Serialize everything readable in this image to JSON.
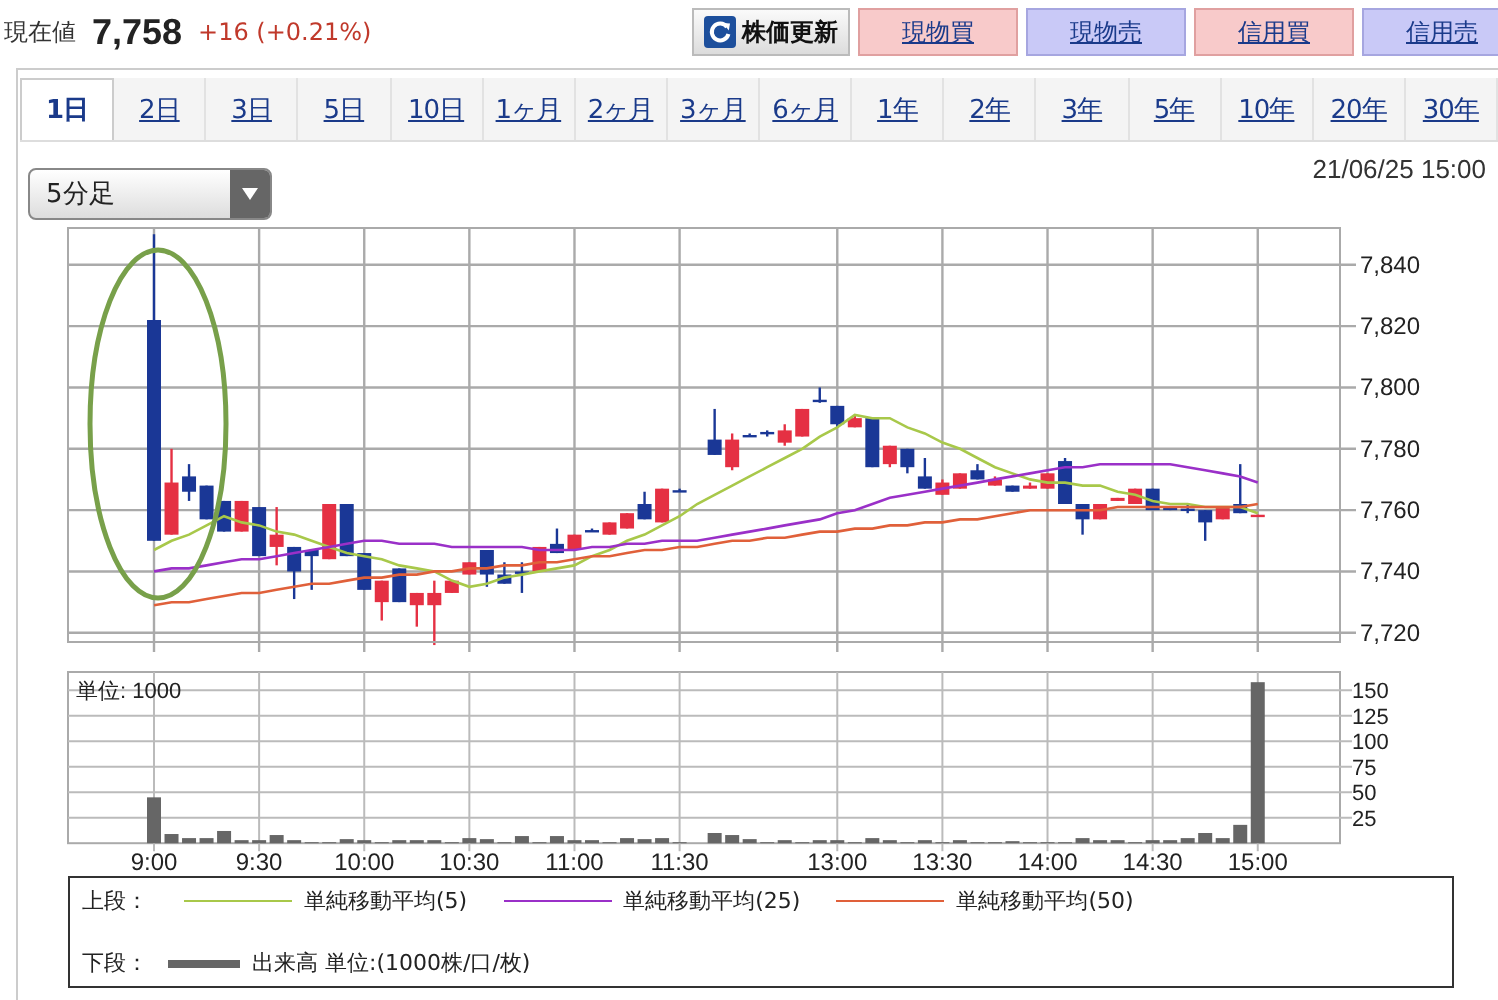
{
  "quote": {
    "label": "現在値",
    "price": "7,758",
    "change": "+16 (+0.21%)"
  },
  "buttons": [
    {
      "label": "株価更新",
      "kind": "refresh"
    },
    {
      "label": "現物買",
      "kind": "buy"
    },
    {
      "label": "現物売",
      "kind": "sell"
    },
    {
      "label": "信用買",
      "kind": "buy"
    },
    {
      "label": "信用売",
      "kind": "sell"
    }
  ],
  "tabs": [
    {
      "label": "1日",
      "selected": true
    },
    {
      "label": "2日",
      "selected": false
    },
    {
      "label": "3日",
      "selected": false
    },
    {
      "label": "5日",
      "selected": false
    },
    {
      "label": "10日",
      "selected": false
    },
    {
      "label": "1ヶ月",
      "selected": false
    },
    {
      "label": "2ヶ月",
      "selected": false
    },
    {
      "label": "3ヶ月",
      "selected": false
    },
    {
      "label": "6ヶ月",
      "selected": false
    },
    {
      "label": "1年",
      "selected": false
    },
    {
      "label": "2年",
      "selected": false
    },
    {
      "label": "3年",
      "selected": false
    },
    {
      "label": "5年",
      "selected": false
    },
    {
      "label": "10年",
      "selected": false
    },
    {
      "label": "20年",
      "selected": false
    },
    {
      "label": "30年",
      "selected": false
    }
  ],
  "interval_select": {
    "value": "5分足"
  },
  "timestamp": "21/06/25 15:00",
  "price_chart": {
    "chart_data": {
      "type": "candlestick",
      "grid": true,
      "ylim": [
        7717,
        7852
      ],
      "ohlc": [
        [
          7822,
          7850,
          7750,
          7750
        ],
        [
          7752,
          7780,
          7752,
          7769
        ],
        [
          7771,
          7775,
          7763,
          7766
        ],
        [
          7768,
          7768,
          7757,
          7757
        ],
        [
          7763,
          7763,
          7753,
          7753
        ],
        [
          7753,
          7763,
          7753,
          7763
        ],
        [
          7761,
          7761,
          7745,
          7745
        ],
        [
          7748,
          7761,
          7742,
          7752
        ],
        [
          7748,
          7748,
          7731,
          7740
        ],
        [
          7747,
          7747,
          7734,
          7745
        ],
        [
          7744,
          7762,
          7744,
          7762
        ],
        [
          7762,
          7762,
          7745,
          7745
        ],
        [
          7746,
          7746,
          7734,
          7734
        ],
        [
          7730,
          7737,
          7724,
          7737
        ],
        [
          7741,
          7741,
          7730,
          7730
        ],
        [
          7729,
          7733,
          7722,
          7733
        ],
        [
          7729,
          7737,
          7716,
          7733
        ],
        [
          7733,
          7737,
          7733,
          7737
        ],
        [
          7739,
          7743,
          7739,
          7743
        ],
        [
          7747,
          7747,
          7735,
          7739
        ],
        [
          7739,
          7743,
          7736,
          7736
        ],
        [
          7740,
          7743,
          7733,
          7739.5
        ],
        [
          7740,
          7748,
          7740,
          7748
        ],
        [
          7749,
          7754,
          7746,
          7746
        ],
        [
          7747,
          7752,
          7747,
          7752
        ],
        [
          7753.5,
          7754,
          7753,
          7753
        ],
        [
          7752,
          7756,
          7752,
          7756
        ],
        [
          7754,
          7759,
          7754,
          7759
        ],
        [
          7762,
          7766,
          7757,
          7757
        ],
        [
          7756,
          7767,
          7756,
          7767
        ],
        [
          7766.5,
          7767,
          7766,
          7766
        ],
        null,
        [
          7783,
          7793,
          7778,
          7778
        ],
        [
          7774,
          7785,
          7773,
          7783
        ],
        [
          7784.5,
          7785,
          7784,
          7784
        ],
        [
          7785.5,
          7786,
          7784,
          7785
        ],
        [
          7782,
          7788,
          7781,
          7786
        ],
        [
          7784,
          7793,
          7784,
          7793
        ],
        [
          7796,
          7800,
          7795,
          7795.5
        ],
        [
          7794,
          7794,
          7787,
          7788
        ],
        [
          7787,
          7791,
          7787,
          7790
        ],
        [
          7790,
          7790,
          7774,
          7774
        ],
        [
          7775,
          7781,
          7774,
          7781
        ],
        [
          7780,
          7780,
          7772,
          7774
        ],
        [
          7771,
          7777,
          7767,
          7767
        ],
        [
          7765,
          7770,
          7765,
          7769
        ],
        [
          7767,
          7772,
          7767,
          7772
        ],
        [
          7773,
          7775,
          7770,
          7770
        ],
        [
          7768,
          7771,
          7768,
          7770
        ],
        [
          7768,
          7768,
          7766,
          7766
        ],
        [
          7767,
          7769,
          7767,
          7768
        ],
        [
          7767,
          7772,
          7767,
          7772
        ],
        [
          7776,
          7777,
          7762,
          7762
        ],
        [
          7762,
          7762,
          7752,
          7757
        ],
        [
          7757,
          7762,
          7757,
          7762
        ],
        [
          7763,
          7764,
          7763,
          7764
        ],
        [
          7762,
          7767,
          7762,
          7767
        ],
        [
          7767,
          7767,
          7760,
          7760
        ],
        [
          7761,
          7761,
          7760,
          7760
        ],
        [
          7760.5,
          7762,
          7759,
          7760
        ],
        [
          7760,
          7760,
          7750,
          7756
        ],
        [
          7757,
          7761,
          7757,
          7761
        ],
        [
          7762,
          7775,
          7759,
          7759
        ],
        [
          7758,
          7758.5,
          7758,
          7758.5
        ]
      ],
      "categories": [
        null,
        null,
        null,
        null,
        null,
        null,
        null,
        null,
        null,
        null,
        null,
        null,
        null,
        null,
        null,
        null,
        null,
        null,
        null,
        null,
        null,
        null,
        null,
        null,
        null,
        null,
        null,
        null,
        null,
        null,
        null,
        null,
        null,
        null,
        null,
        null,
        null,
        null,
        null,
        null,
        null,
        null,
        null,
        null,
        null,
        null,
        null,
        null,
        null,
        null,
        null,
        null,
        null,
        null,
        null,
        null,
        null,
        null,
        null,
        null,
        null,
        null,
        null,
        null
      ],
      "yticks": [
        {
          "value": 7720,
          "label": "7,720"
        },
        {
          "value": 7740,
          "label": "7,740"
        },
        {
          "value": 7760,
          "label": "7,760"
        },
        {
          "value": 7780,
          "label": "7,780"
        },
        {
          "value": 7800,
          "label": "7,800"
        },
        {
          "value": 7820,
          "label": "7,820"
        },
        {
          "value": 7840,
          "label": "7,840"
        }
      ]
    },
    "moving_averages": {
      "chart_data": {
        "type": "line",
        "ylim": [
          7717,
          7852
        ],
        "series": [
          {
            "name": "単純移動平均(5)",
            "color": "#a8c84a",
            "values": [
              7747,
              7750,
              7752,
              7755,
              7758,
              7756,
              7755,
              7753,
              7752,
              7750,
              7748,
              7746,
              7745,
              7744,
              7742,
              7741,
              7740,
              7737,
              7735,
              7736,
              7738,
              7739,
              7740,
              7741,
              7742,
              7745,
              7747,
              7750,
              7752,
              7755,
              7758,
              7762,
              7765,
              7768,
              7771,
              7774,
              7777,
              7780,
              7784,
              7787,
              7791,
              7790,
              7790,
              7787,
              7785,
              7782,
              7780,
              7777,
              7774,
              7772,
              7770,
              7769,
              7769,
              7768,
              7768,
              7766,
              7765,
              7763,
              7762,
              7762,
              7761,
              7761,
              7761,
              7759
            ]
          },
          {
            "name": "単純移動平均(25)",
            "color": "#9a30c8",
            "values": [
              7740,
              7741,
              7741,
              7742,
              7743,
              7744,
              7744,
              7745,
              7746,
              7747,
              7748,
              7749,
              7750,
              7750,
              7749,
              7749,
              7749,
              7748,
              7748,
              7748,
              7748,
              7748,
              7747,
              7747,
              7747,
              7748,
              7748,
              7749,
              7749,
              7750,
              7750,
              7750,
              7751,
              7752,
              7753,
              7754,
              7755,
              7756,
              7757,
              7759,
              7760,
              7762,
              7764,
              7765,
              7766,
              7767,
              7768,
              7769,
              7770,
              7771,
              7772,
              7773,
              7774,
              7774,
              7775,
              7775,
              7775,
              7775,
              7775,
              7774,
              7773,
              7772,
              7771,
              7769
            ]
          },
          {
            "name": "単純移動平均(50)",
            "color": "#e0603a",
            "values": [
              7729,
              7730,
              7730,
              7731,
              7732,
              7733,
              7733,
              7734,
              7735,
              7736,
              7736,
              7737,
              7738,
              7738,
              7739,
              7739,
              7740,
              7740,
              7741,
              7741,
              7742,
              7742,
              7743,
              7743,
              7744,
              7745,
              7745,
              7746,
              7747,
              7747,
              7748,
              7748,
              7749,
              7750,
              7750,
              7751,
              7751,
              7752,
              7753,
              7753,
              7754,
              7754,
              7755,
              7755,
              7756,
              7756,
              7757,
              7757,
              7758,
              7759,
              7760,
              7760,
              7760,
              7760,
              7760,
              7761,
              7761,
              7761,
              7761,
              7761,
              7761,
              7761,
              7761,
              7762
            ]
          }
        ]
      }
    }
  },
  "volume_chart": {
    "unit_label": "単位: 1000",
    "chart_data": {
      "type": "bar",
      "grid": true,
      "ylim": [
        0,
        168
      ],
      "categories": [
        "9:00",
        null,
        null,
        null,
        null,
        null,
        "9:30",
        null,
        null,
        null,
        null,
        null,
        "10:00",
        null,
        null,
        null,
        null,
        null,
        "10:30",
        null,
        null,
        null,
        null,
        null,
        "11:00",
        null,
        null,
        null,
        null,
        null,
        "11:30",
        null,
        null,
        null,
        null,
        null,
        null,
        null,
        null,
        "13:00",
        null,
        null,
        null,
        null,
        null,
        "13:30",
        null,
        null,
        null,
        null,
        null,
        "14:00",
        null,
        null,
        null,
        null,
        null,
        "14:30",
        null,
        null,
        null,
        null,
        null,
        "15:00"
      ],
      "series": [
        {
          "name": "出来高 単位:(1000株/口/枚)",
          "color": "#666666",
          "values": [
            45,
            9,
            5,
            5,
            12,
            3,
            3,
            8,
            3,
            1,
            1,
            4,
            3,
            1,
            3,
            3,
            3,
            1,
            5,
            4,
            1,
            7,
            1,
            7,
            3,
            3,
            1,
            5,
            4,
            5,
            1,
            null,
            10,
            8,
            4,
            1,
            3,
            1,
            3,
            3,
            1,
            5,
            3,
            1,
            3,
            1,
            3,
            1,
            1,
            2,
            1,
            1,
            1,
            5,
            3,
            3,
            1,
            3,
            3,
            5,
            10,
            5,
            18,
            158
          ]
        }
      ],
      "yticks": [
        25,
        50,
        75,
        100,
        125,
        150
      ]
    }
  },
  "legend": {
    "upper_label": "上段：",
    "lower_label": "下段："
  }
}
